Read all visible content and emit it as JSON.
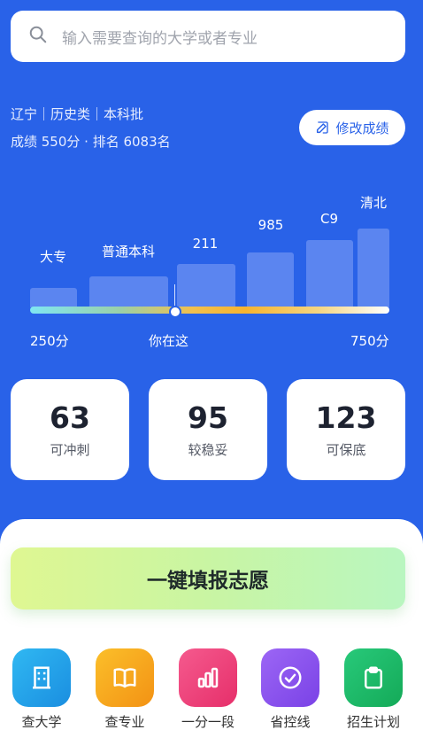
{
  "search": {
    "placeholder": "输入需要查询的大学或者专业"
  },
  "profile": {
    "line1": "辽宁｜历史类｜本科批",
    "line2": "成绩 550分 · 排名 6083名",
    "edit_label": "修改成绩"
  },
  "chart_data": {
    "type": "bar",
    "categories": [
      "大专",
      "普通本科",
      "211",
      "985",
      "C9",
      "清北"
    ],
    "x_range": [
      250,
      750
    ],
    "x_labels": [
      "250分",
      "你在这",
      "750分"
    ],
    "current_score": 550
  },
  "stats": [
    {
      "num": "63",
      "label": "可冲刺"
    },
    {
      "num": "95",
      "label": "较稳妥"
    },
    {
      "num": "123",
      "label": "可保底"
    }
  ],
  "cta": {
    "label": "一键填报志愿"
  },
  "nav": [
    {
      "label": "查大学",
      "icon": "building-icon",
      "color": "#1fa2e8"
    },
    {
      "label": "查专业",
      "icon": "book-icon",
      "color": "#f7a51c"
    },
    {
      "label": "一分一段",
      "icon": "bar-chart-icon",
      "color": "#ee3f7a"
    },
    {
      "label": "省控线",
      "icon": "check-circle-icon",
      "color": "#8a54ee"
    },
    {
      "label": "招生计划",
      "icon": "clipboard-icon",
      "color": "#1bbd6a"
    }
  ]
}
